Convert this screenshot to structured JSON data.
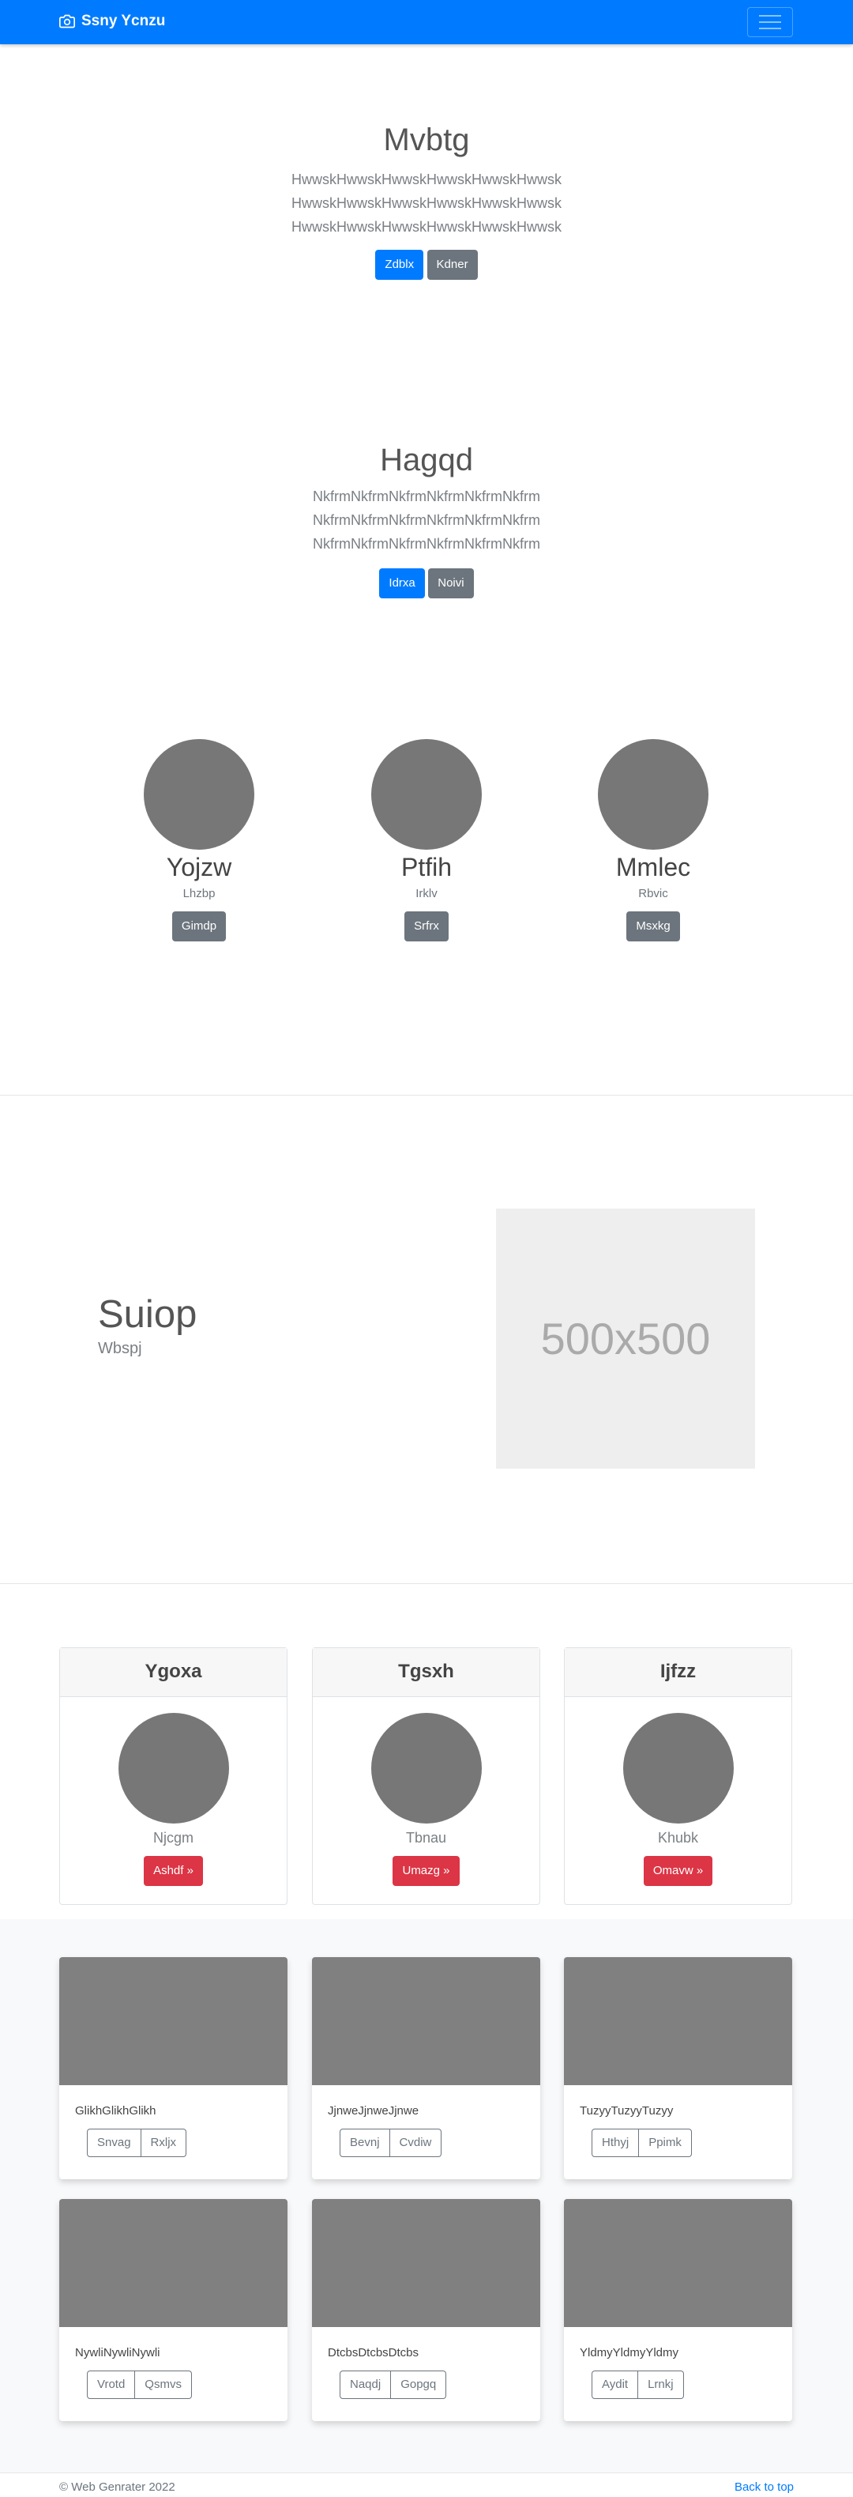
{
  "navbar": {
    "brand": "Ssny Ycnzu"
  },
  "hero1": {
    "title": "Mvbtg",
    "lines": [
      "HwwskHwwskHwwskHwwskHwwskHwwsk",
      "HwwskHwwskHwwskHwwskHwwskHwwsk",
      "HwwskHwwskHwwskHwwskHwwskHwwsk"
    ],
    "primary": "Zdblx",
    "secondary": "Kdner"
  },
  "hero2": {
    "title": "Hagqd",
    "lines": [
      "NkfrmNkfrmNkfrmNkfrmNkfrmNkfrm",
      "NkfrmNkfrmNkfrmNkfrmNkfrmNkfrm",
      "NkfrmNkfrmNkfrmNkfrmNkfrmNkfrm"
    ],
    "primary": "Idrxa",
    "secondary": "Noivi"
  },
  "team": [
    {
      "name": "Yojzw",
      "role": "Lhzbp",
      "button": "Gimdp"
    },
    {
      "name": "Ptfih",
      "role": "Irklv",
      "button": "Srfrx"
    },
    {
      "name": "Mmlec",
      "role": "Rbvic",
      "button": "Msxkg"
    }
  ],
  "feature": {
    "title": "Suiop",
    "subtitle": "Wbspj",
    "placeholder": "500x500"
  },
  "pricing": [
    {
      "title": "Ygoxa",
      "subtitle": "Njcgm",
      "button": "Ashdf »"
    },
    {
      "title": "Tgsxh",
      "subtitle": "Tbnau",
      "button": "Umazg »"
    },
    {
      "title": "Ijfzz",
      "subtitle": "Khubk",
      "button": "Omavw »"
    }
  ],
  "album": [
    {
      "text": "GlikhGlikhGlikh",
      "b1": "Snvag",
      "b2": "Rxljx"
    },
    {
      "text": "JjnweJjnweJjnwe",
      "b1": "Bevnj",
      "b2": "Cvdiw"
    },
    {
      "text": "TuzyyTuzyyTuzyy",
      "b1": "Hthyj",
      "b2": "Ppimk"
    },
    {
      "text": "NywliNywliNywli",
      "b1": "Vrotd",
      "b2": "Qsmvs"
    },
    {
      "text": "DtcbsDtcbsDtcbs",
      "b1": "Naqdj",
      "b2": "Gopgq"
    },
    {
      "text": "YldmyYldmyYldmy",
      "b1": "Aydit",
      "b2": "Lrnkj"
    }
  ],
  "footer": {
    "copyright": "© Web Genrater 2022",
    "back_to_top": "Back to top"
  },
  "colors": {
    "primary": "#007bff",
    "secondary": "#6c757d",
    "danger": "#dc3545"
  }
}
